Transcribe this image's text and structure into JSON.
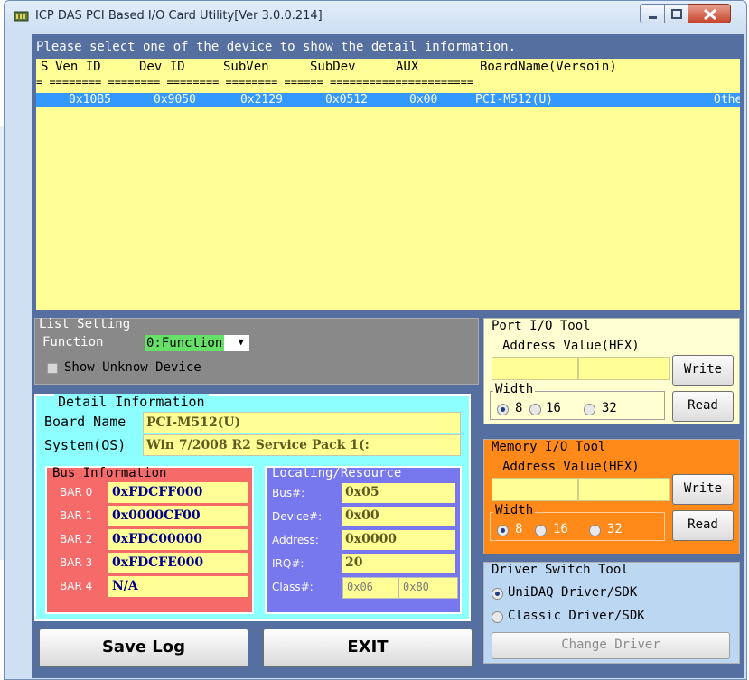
{
  "window": {
    "title": "ICP DAS PCI Based I/O Card Utility[Ver 3.0.0.214]"
  },
  "device_list": {
    "hint": "Please select one of the device to show the detail information.",
    "columns": [
      "S",
      "Ven ID",
      "Dev ID",
      "SubVen",
      "SubDev",
      "AUX",
      "BoardName(Versoin)"
    ],
    "separator": "= ======== ======== ======== ======== ====== ======================",
    "rows": [
      {
        "ven": "0x10B5",
        "dev": "0x9050",
        "subven": "0x2129",
        "subdev": "0x0512",
        "aux": "0x00",
        "board": "PCI-M512(U)",
        "extra": "Othe"
      }
    ]
  },
  "list_setting": {
    "title": "List Setting",
    "function_label": "Function",
    "function_value": "0:Function",
    "show_unknown_label": "Show Unknow Device",
    "show_unknown_checked": false
  },
  "detail": {
    "title": "Detail Information",
    "board_name_label": "Board Name",
    "board_name": "PCI-M512(U)",
    "system_label": "System(OS)",
    "system": "Win 7/2008 R2 Service Pack 1(:"
  },
  "bus": {
    "title": "Bus Information",
    "bars": [
      {
        "label": "BAR 0",
        "value": "0xFDCFF000"
      },
      {
        "label": "BAR 1",
        "value": "0x0000CF00"
      },
      {
        "label": "BAR 2",
        "value": "0xFDC00000"
      },
      {
        "label": "BAR 3",
        "value": "0xFDCFE000"
      },
      {
        "label": "BAR 4",
        "value": "N/A"
      }
    ]
  },
  "locating": {
    "title": "Locating/Resource",
    "bus_label": "Bus#:",
    "bus": "0x05",
    "device_label": "Device#:",
    "device": "0x00",
    "address_label": "Address:",
    "address": "0x0000",
    "irq_label": "IRQ#:",
    "irq": "20",
    "class_label": "Class#:",
    "class1": "0x06",
    "class2": "0x80"
  },
  "port_io": {
    "title": "Port I/O Tool",
    "addr_label": "Address Value(HEX)",
    "write": "Write",
    "read": "Read",
    "width_label": "Width",
    "widths": [
      "8",
      "16",
      "32"
    ],
    "selected_width": "8"
  },
  "memory_io": {
    "title": "Memory I/O Tool",
    "addr_label": "Address Value(HEX)",
    "write": "Write",
    "read": "Read",
    "width_label": "Width",
    "widths": [
      "8",
      "16",
      "32"
    ],
    "selected_width": "8"
  },
  "driver_switch": {
    "title": "Driver Switch Tool",
    "option1": "UniDAQ Driver/SDK",
    "option2": "Classic Driver/SDK",
    "selected": "UniDAQ Driver/SDK",
    "change_button": "Change Driver"
  },
  "buttons": {
    "save_log": "Save Log",
    "exit": "EXIT"
  },
  "colors": {
    "client_bg": "#566fa1",
    "list_bg": "#ffff96",
    "selection": "#3399ff",
    "detail_bg": "#8dffff",
    "bus_bg": "#f66a6a",
    "loc_bg": "#7777ee",
    "port_bg": "#ffffd2",
    "memory_bg": "#ff8a1a",
    "driver_bg": "#bcd7f2"
  }
}
